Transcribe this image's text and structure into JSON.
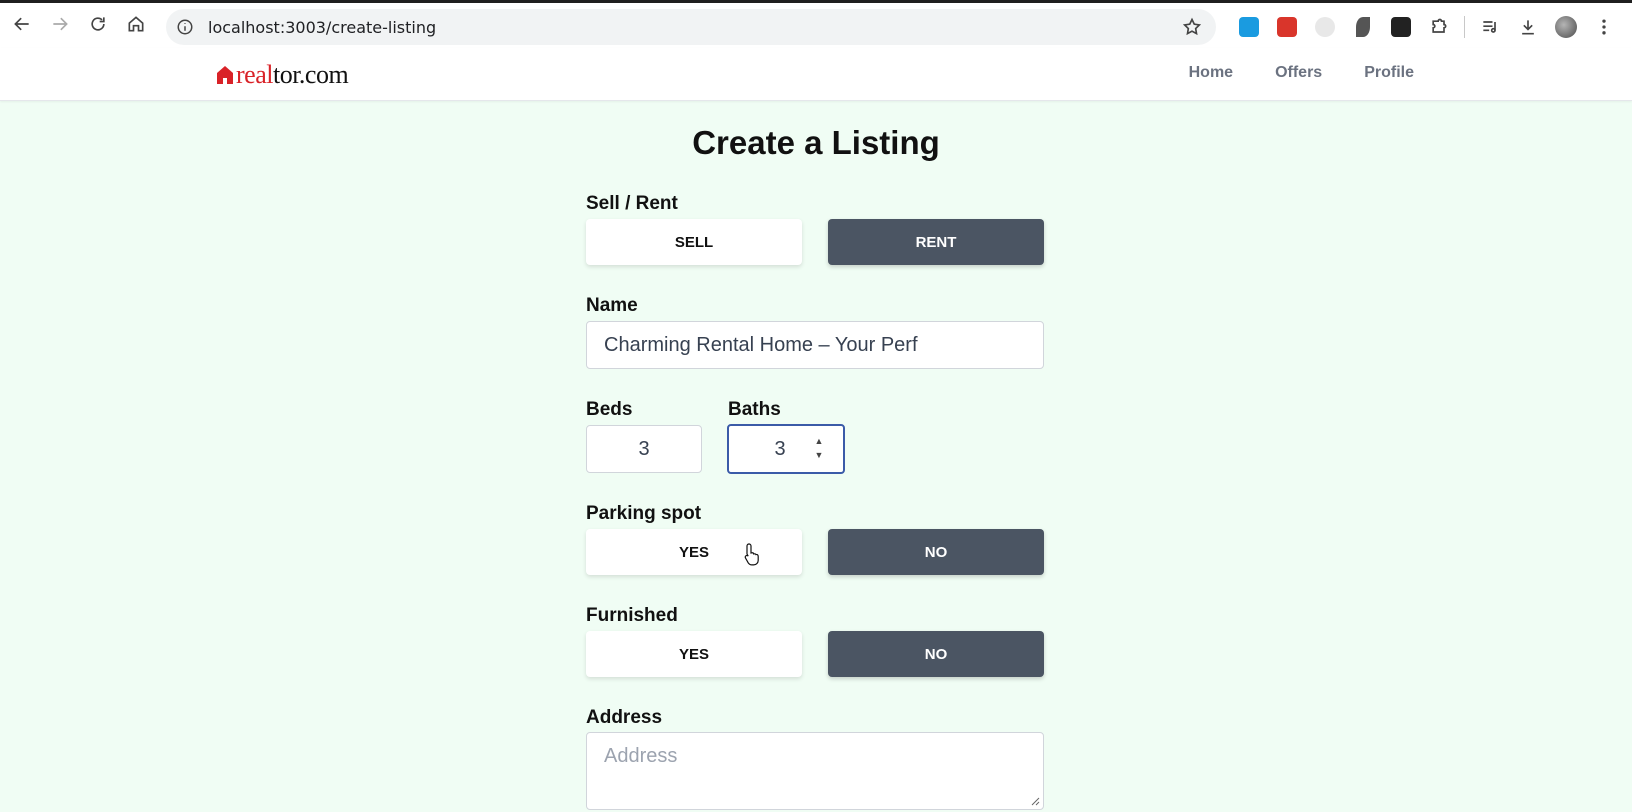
{
  "browser": {
    "url": "localhost:3003/create-listing"
  },
  "site": {
    "logo_red": "real",
    "logo_dark": "tor.com",
    "nav": [
      "Home",
      "Offers",
      "Profile"
    ]
  },
  "form": {
    "title": "Create a Listing",
    "sell_rent": {
      "label": "Sell / Rent",
      "sell": "SELL",
      "rent": "RENT",
      "selected": "RENT"
    },
    "name": {
      "label": "Name",
      "value": "Charming Rental Home – Your Perf"
    },
    "beds": {
      "label": "Beds",
      "value": "3"
    },
    "baths": {
      "label": "Baths",
      "value": "3"
    },
    "parking": {
      "label": "Parking spot",
      "yes": "YES",
      "no": "NO",
      "selected": "NO"
    },
    "furnished": {
      "label": "Furnished",
      "yes": "YES",
      "no": "NO",
      "selected": "NO"
    },
    "address": {
      "label": "Address",
      "placeholder": "Address"
    }
  },
  "colors": {
    "background": "#f0fdf4",
    "dark_button": "#4b5563",
    "brand_red": "#d92228"
  }
}
